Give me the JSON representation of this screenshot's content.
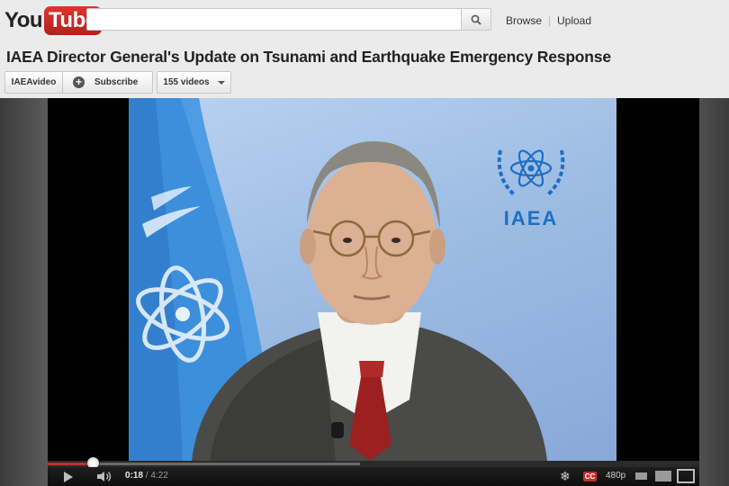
{
  "header": {
    "logo_you": "You",
    "logo_tube": "Tube",
    "search_value": "",
    "search_icon": "search-icon",
    "nav_browse": "Browse",
    "nav_separator": "|",
    "nav_upload": "Upload"
  },
  "video": {
    "title": "IAEA Director General's Update on Tsunami and Earthquake Emergency Response",
    "channel": "IAEAvideo",
    "subscribe_label": "Subscribe",
    "subscribe_icon": "+",
    "videos_label": "155 videos",
    "frame_logo_text": "IAEA"
  },
  "player": {
    "current_time": "0:18",
    "time_separator": " / ",
    "duration": "4:22",
    "played_fraction": 0.069,
    "loaded_fraction": 0.479,
    "cc_label": "CC",
    "quality_label": "480p",
    "accent": "#c4302b"
  }
}
